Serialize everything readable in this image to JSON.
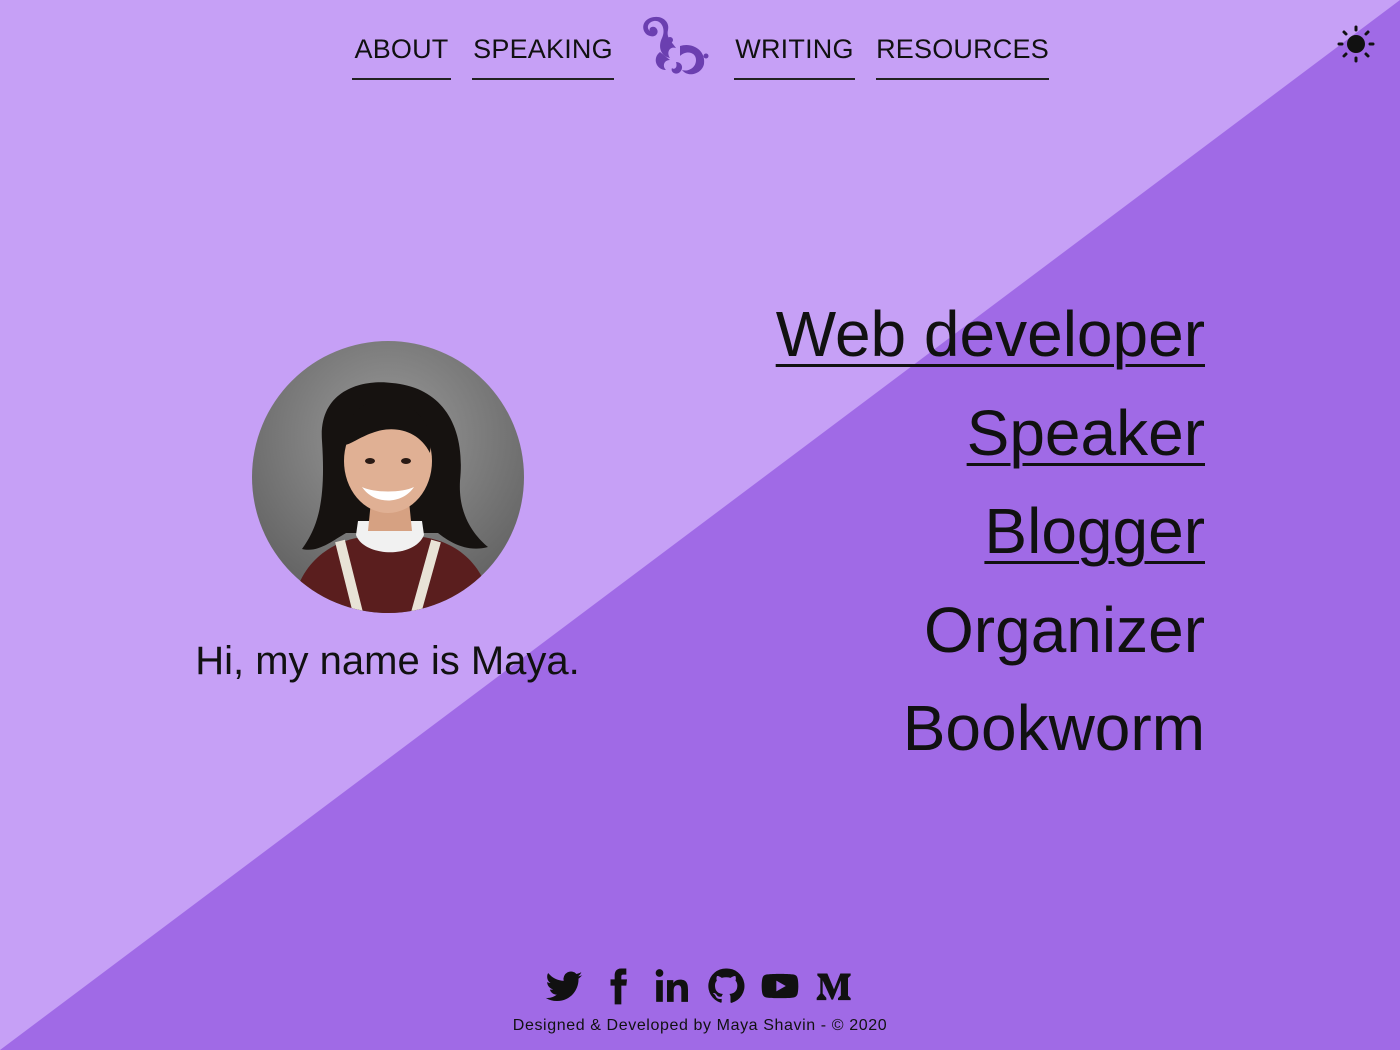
{
  "theme": {
    "background_light": "#c6a0f6",
    "background_dark": "#a06ae6",
    "ink": "#111111",
    "logo_color": "#6b3fb0"
  },
  "nav": {
    "links": [
      {
        "label": "ABOUT"
      },
      {
        "label": "SPEAKING"
      },
      {
        "label": "WRITING"
      },
      {
        "label": "RESOURCES"
      }
    ],
    "logo_icon": "swirl-logo-icon",
    "theme_toggle_icon": "sun-icon"
  },
  "hero": {
    "avatar_icon": "profile-photo",
    "greeting": "Hi, my name is Maya.",
    "roles": [
      {
        "label": "Web developer",
        "link": true
      },
      {
        "label": "Speaker",
        "link": true
      },
      {
        "label": "Blogger",
        "link": true
      },
      {
        "label": "Organizer",
        "link": false
      },
      {
        "label": "Bookworm",
        "link": false
      }
    ]
  },
  "footer": {
    "social": [
      "twitter-icon",
      "facebook-icon",
      "linkedin-icon",
      "github-icon",
      "youtube-icon",
      "medium-icon"
    ],
    "credit": "Designed & Developed by Maya Shavin - © 2020"
  }
}
